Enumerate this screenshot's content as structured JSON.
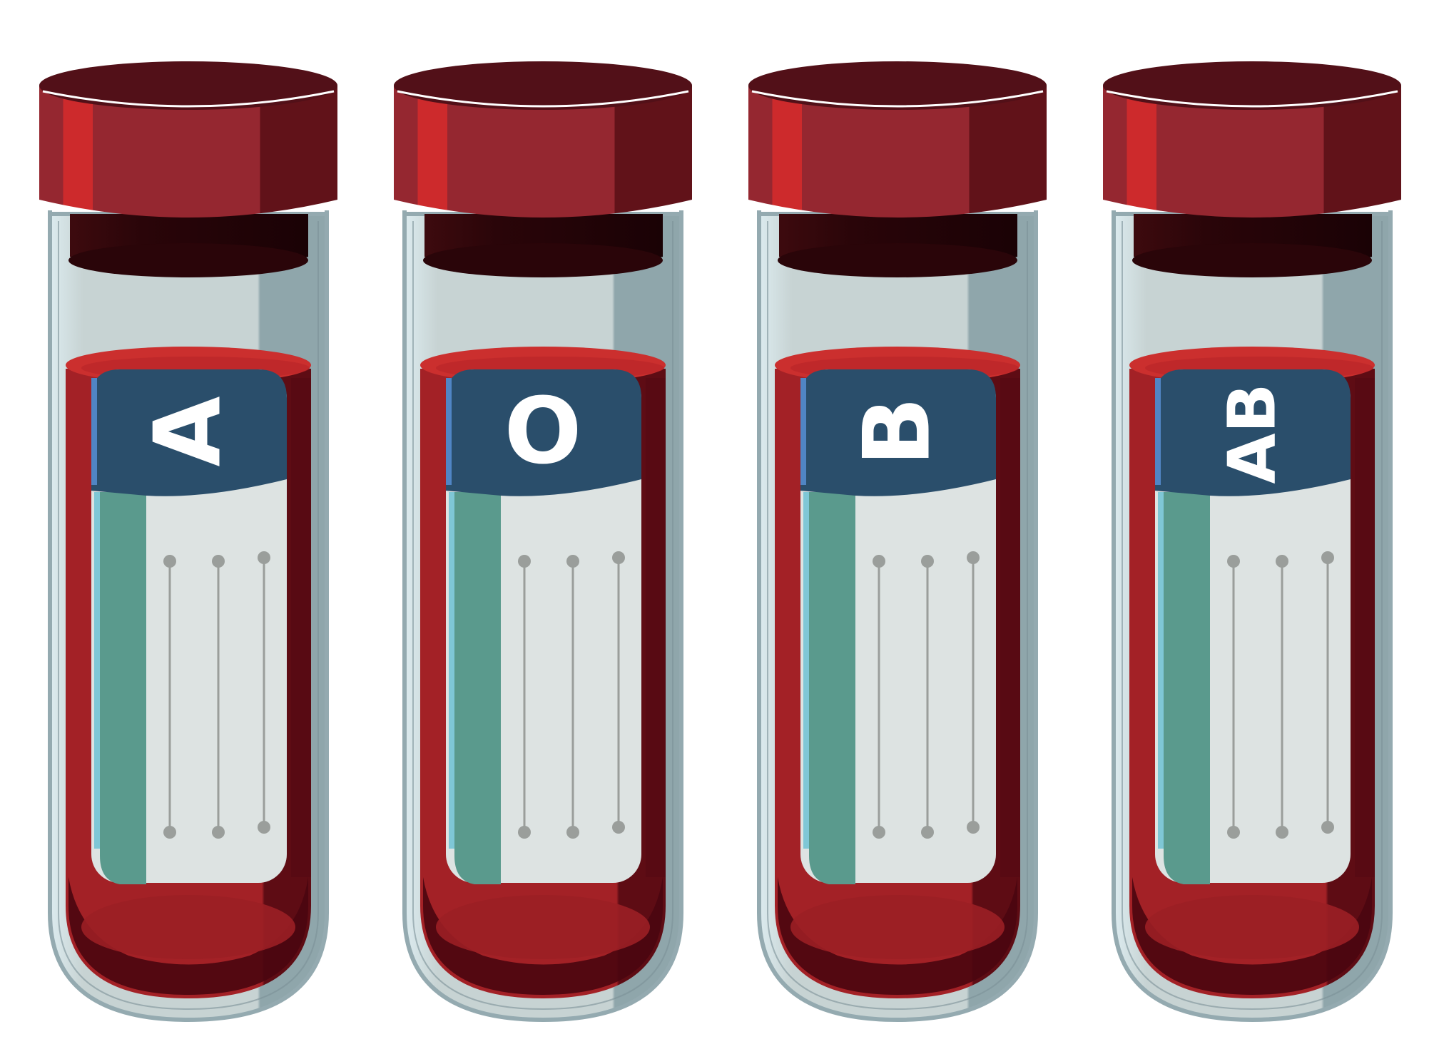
{
  "tubes": [
    {
      "label": "A"
    },
    {
      "label": "O"
    },
    {
      "label": "B"
    },
    {
      "label": "AB"
    }
  ],
  "colors": {
    "background": "#ffffff",
    "cap_top": "#521018",
    "cap_body": "#952730",
    "cap_highlight": "#cd2a2c",
    "cap_shadow": "#611219",
    "stopper": "#2a0509",
    "glass_outline": "#94aab0",
    "glass_fill": "#c7d3d3",
    "glass_highlight": "#dcebef",
    "blood_surface": "#cb2f2e",
    "blood_body": "#a32126",
    "blood_dark": "#5e0c14",
    "blood_bottom": "#4a0510",
    "label_header": "#2a4e6b",
    "label_edge": "#5085c4",
    "label_paper": "#dde3e2",
    "label_stripe": "#5a9a8d",
    "label_lines": "#9a9e9b"
  }
}
